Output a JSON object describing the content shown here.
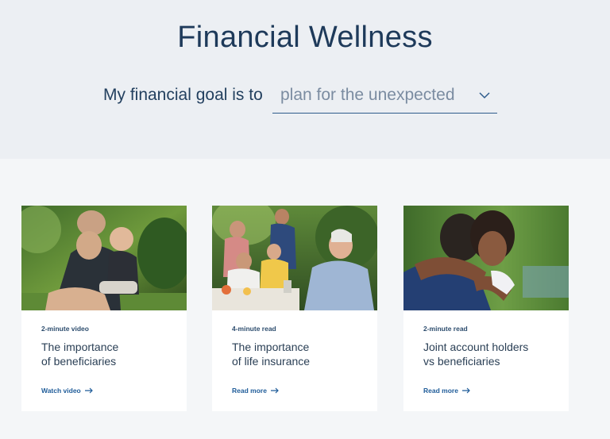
{
  "page": {
    "title": "Financial Wellness"
  },
  "goal": {
    "label": "My financial goal is to",
    "selected": "plan for the unexpected"
  },
  "cards": [
    {
      "meta": "2-minute video",
      "title_line1": "The importance",
      "title_line2": "of beneficiaries",
      "link": "Watch video",
      "image": "grandfather-holding-baby-photo"
    },
    {
      "meta": "4-minute read",
      "title_line1": "The importance",
      "title_line2": "of life insurance",
      "link": "Read more",
      "image": "family-outdoor-gathering-photo"
    },
    {
      "meta": "2-minute read",
      "title_line1": "Joint account holders",
      "title_line2": "vs beneficiaries",
      "link": "Read more",
      "image": "father-daughter-hug-photo"
    }
  ],
  "colors": {
    "hero_bg": "#eceff3",
    "page_bg": "#f4f6f8",
    "title": "#1e3a5a",
    "link": "#1f5c99",
    "select_border": "#2e5c8c"
  }
}
